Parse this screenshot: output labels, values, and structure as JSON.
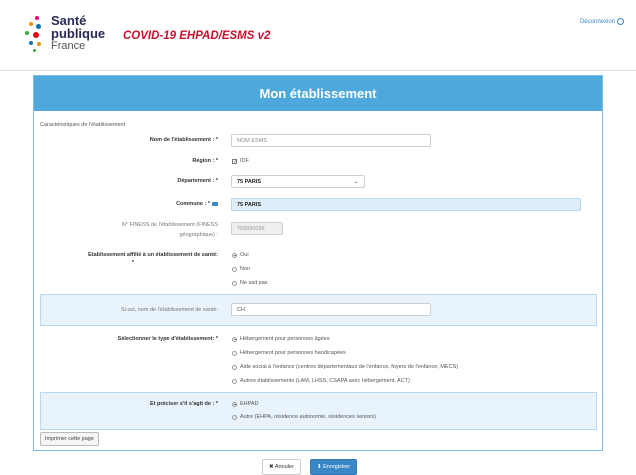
{
  "header": {
    "logo_line1": "Santé",
    "logo_line2": "publique",
    "logo_line3": "France",
    "app_title": "COVID-19 EHPAD/ESMS v2",
    "logout_label": "Déconnexion"
  },
  "panel": {
    "title": "Mon établissement",
    "section_title": "Caractéristiques de l'établissement"
  },
  "form": {
    "name_label": "Nom de l'établissement : *",
    "name_placeholder": "NOM ESMS",
    "region_label": "Région : *",
    "region_value": "IDF",
    "department_label": "Département : *",
    "department_value": "75 PARIS",
    "commune_label": "Commune : *",
    "commune_value": "75 PARIS",
    "finess_label_1": "N° FINESS de l'établissement (FINESS",
    "finess_label_2": "géographique) :",
    "finess_value": "750000036",
    "affiliated_label": "Etablissement affilié à un établissement de santé:",
    "affiliated_required": "*",
    "affiliated_options": [
      "Oui",
      "Non",
      "Ne sait pas"
    ],
    "health_name_label": "Si oui, nom de l'établissement de santé:",
    "health_name_value": "CH",
    "type_label": "Sélectionner le type d'établissement: *",
    "type_options": [
      "Hébergement pour personnes âgées",
      "Hébergement pour personnes handicapées",
      "Aide social à l'enfance (centres départementaux de l'enfance, foyers de l'enfance, MECS)",
      "Autres établissements (LAM, LHSS, CSAPA avec hébergement, ACT)"
    ],
    "precise_label": "Et préciser s'il s'agit de : *",
    "precise_options": [
      "EHPAD",
      "Autre (EHPA, résidence autonomie, résidences seniors)"
    ],
    "print_label": "Imprimer cette page"
  },
  "actions": {
    "cancel_label": "✖ Annuler",
    "save_label": "⬇ Enregistrer"
  },
  "colors": {
    "panel_header": "#4fa8dc",
    "title_red": "#c8102e",
    "link_blue": "#3a87c7"
  }
}
